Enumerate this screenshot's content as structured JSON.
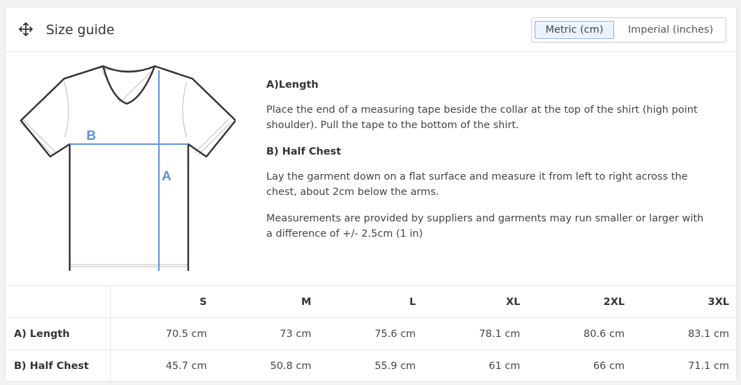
{
  "header": {
    "title": "Size guide",
    "icon": "move-icon",
    "units": {
      "metric_label": "Metric (cm)",
      "imperial_label": "Imperial (inches)",
      "selected": "metric"
    }
  },
  "figure": {
    "label_a": "A",
    "label_b": "B",
    "accent_color": "#5b93d8"
  },
  "description": {
    "length_heading": "A)Length",
    "length_text": "Place the end of a measuring tape beside the collar at the top of the shirt (high point shoulder). Pull the tape to the bottom of the shirt.",
    "chest_heading": "B) Half Chest",
    "chest_text": "Lay the garment down on a flat surface and measure it from left to right across the chest, about 2cm below the arms.",
    "note": "Measurements are provided by suppliers and garments may run smaller or larger with a difference of +/- 2.5cm (1 in)"
  },
  "table": {
    "columns": [
      "S",
      "M",
      "L",
      "XL",
      "2XL",
      "3XL"
    ],
    "rows": [
      {
        "label": "A) Length",
        "values": [
          "70.5 cm",
          "73 cm",
          "75.6 cm",
          "78.1 cm",
          "80.6 cm",
          "83.1 cm"
        ]
      },
      {
        "label": "B) Half Chest",
        "values": [
          "45.7 cm",
          "50.8 cm",
          "55.9 cm",
          "61 cm",
          "66 cm",
          "71.1 cm"
        ]
      }
    ]
  }
}
